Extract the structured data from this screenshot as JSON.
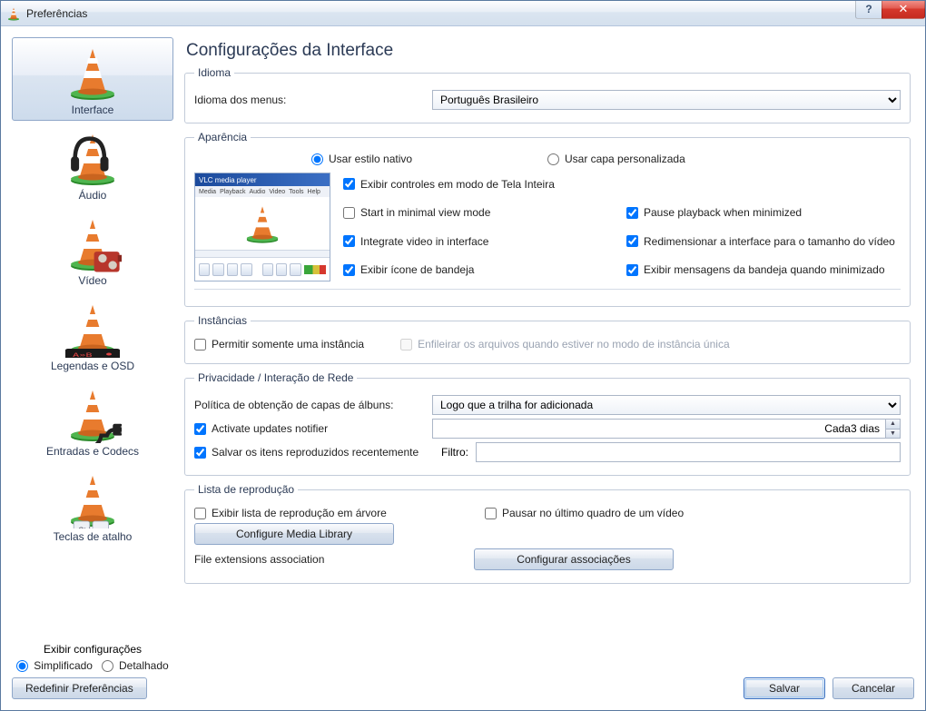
{
  "window": {
    "title": "Preferências"
  },
  "sidebar": {
    "items": [
      {
        "label": "Interface"
      },
      {
        "label": "Áudio"
      },
      {
        "label": "Vídeo"
      },
      {
        "label": "Legendas e OSD"
      },
      {
        "label": "Entradas e Codecs"
      },
      {
        "label": "Teclas de atalho"
      }
    ],
    "show_settings_label": "Exibir configurações",
    "mode_simple": "Simplificado",
    "mode_detailed": "Detalhado"
  },
  "main": {
    "title": "Configurações da Interface"
  },
  "idioma": {
    "legend": "Idioma",
    "menu_label": "Idioma dos menus:",
    "menu_value": "Português Brasileiro"
  },
  "aparencia": {
    "legend": "Aparência",
    "native": "Usar estilo nativo",
    "custom": "Usar capa personalizada",
    "preview_title": "VLC media player",
    "checks": {
      "fullscreen_controls": "Exibir controles em modo de Tela Inteira",
      "minimal_view": "Start in minimal view mode",
      "integrate_video": "Integrate video in interface",
      "tray_icon": "Exibir ícone de bandeja",
      "pause_minimized": "Pause playback when minimized",
      "resize_interface": "Redimensionar a interface para o tamanho do vídeo",
      "tray_messages": "Exibir mensagens da bandeja quando minimizado"
    }
  },
  "instancias": {
    "legend": "Instâncias",
    "single": "Permitir somente uma instância",
    "enqueue": "Enfileirar os arquivos quando estiver no modo de instância única"
  },
  "privacidade": {
    "legend": "Privacidade / Interação de Rede",
    "album_label": "Política de obtenção de capas de álbuns:",
    "album_value": "Logo que a trilha for adicionada",
    "updates": "Activate updates notifier",
    "updates_interval": "Cada3 dias",
    "save_recent": "Salvar os itens reproduzidos recentemente",
    "filter_label": "Filtro:"
  },
  "lista": {
    "legend": "Lista de reprodução",
    "tree": "Exibir lista de reprodução em árvore",
    "pause_last": "Pausar no último quadro de um vídeo",
    "configure_media": "Configure Media Library",
    "file_ext_label": "File extensions association",
    "configure_assoc": "Configurar associações"
  },
  "footer": {
    "reset": "Redefinir Preferências",
    "save": "Salvar",
    "cancel": "Cancelar"
  }
}
